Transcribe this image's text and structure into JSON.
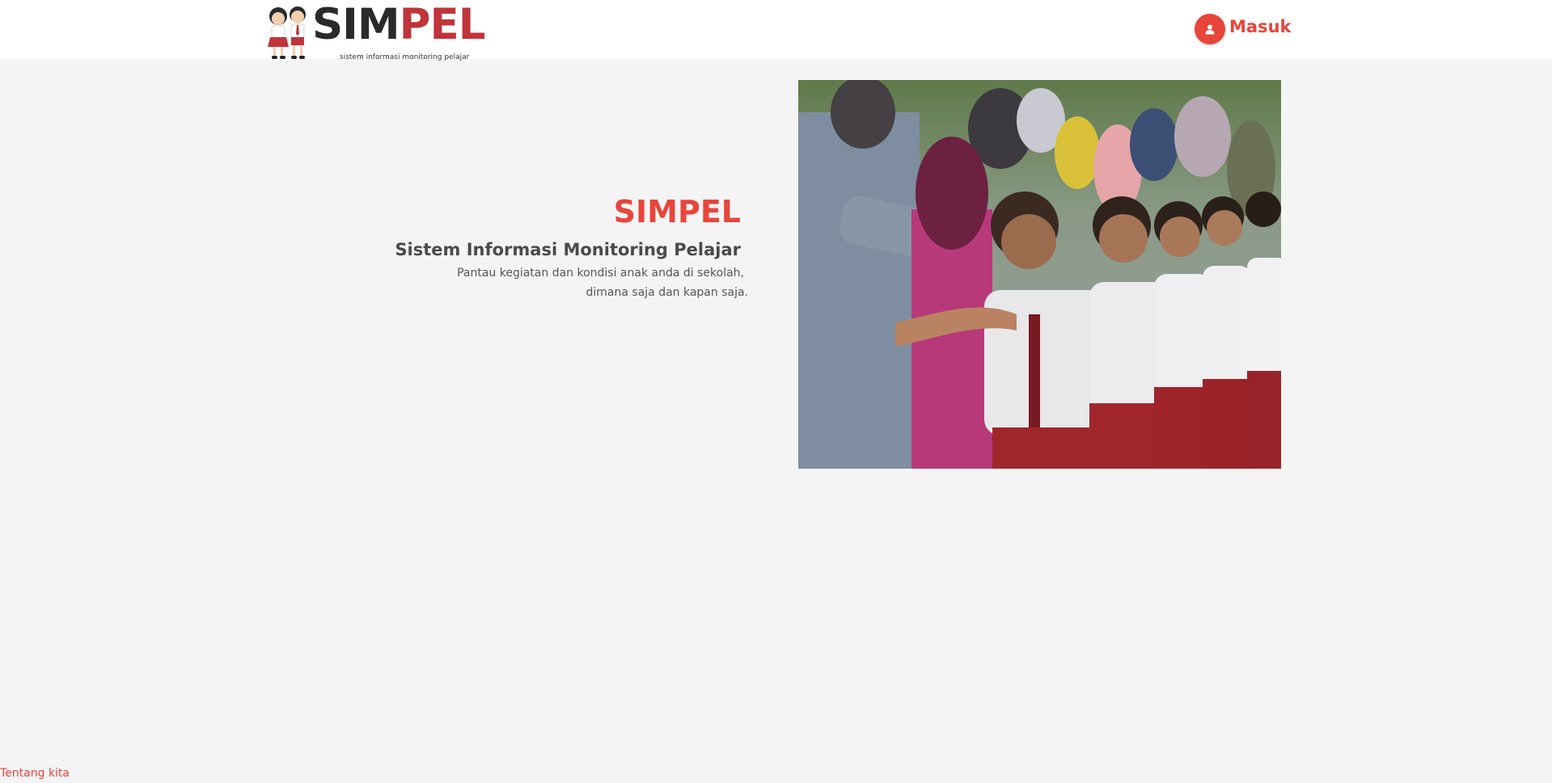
{
  "header": {
    "logo": {
      "name_part1": "SIM",
      "name_part2": "PEL",
      "tagline": "sistem informasi monitoring pelajar"
    },
    "login": {
      "icon": "user-icon",
      "label": "Masuk"
    }
  },
  "hero": {
    "title": "SIMPEL",
    "subtitle": "Sistem Informasi Monitoring Pelajar",
    "description_line1": "Pantau kegiatan dan kondisi anak anda di sekolah,",
    "description_line2": "dimana saja dan kapan saja."
  },
  "footer": {
    "link": "Tentang kita"
  },
  "colors": {
    "accent": "#e8453c",
    "logo_red": "#c0343b",
    "logo_dark": "#2a2a2a",
    "page_bg": "#f4f4f4",
    "header_bg": "#ffffff"
  }
}
